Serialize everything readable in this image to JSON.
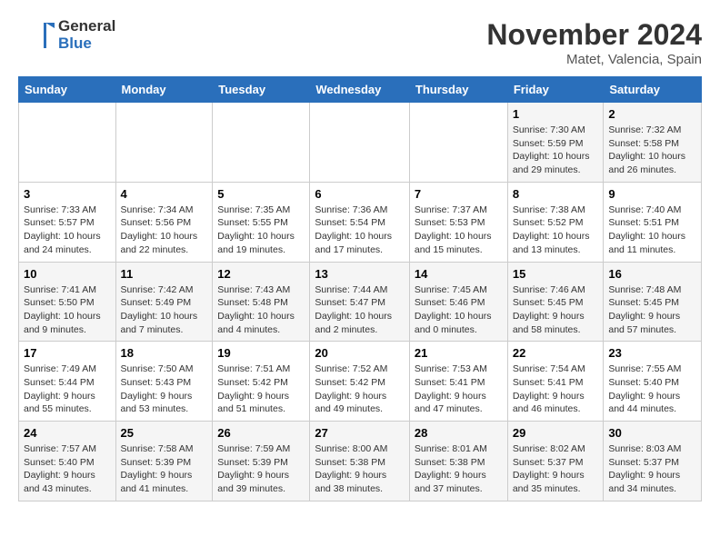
{
  "logo": {
    "line1": "General",
    "line2": "Blue"
  },
  "title": "November 2024",
  "location": "Matet, Valencia, Spain",
  "weekdays": [
    "Sunday",
    "Monday",
    "Tuesday",
    "Wednesday",
    "Thursday",
    "Friday",
    "Saturday"
  ],
  "weeks": [
    [
      {
        "day": "",
        "info": ""
      },
      {
        "day": "",
        "info": ""
      },
      {
        "day": "",
        "info": ""
      },
      {
        "day": "",
        "info": ""
      },
      {
        "day": "",
        "info": ""
      },
      {
        "day": "1",
        "info": "Sunrise: 7:30 AM\nSunset: 5:59 PM\nDaylight: 10 hours and 29 minutes."
      },
      {
        "day": "2",
        "info": "Sunrise: 7:32 AM\nSunset: 5:58 PM\nDaylight: 10 hours and 26 minutes."
      }
    ],
    [
      {
        "day": "3",
        "info": "Sunrise: 7:33 AM\nSunset: 5:57 PM\nDaylight: 10 hours and 24 minutes."
      },
      {
        "day": "4",
        "info": "Sunrise: 7:34 AM\nSunset: 5:56 PM\nDaylight: 10 hours and 22 minutes."
      },
      {
        "day": "5",
        "info": "Sunrise: 7:35 AM\nSunset: 5:55 PM\nDaylight: 10 hours and 19 minutes."
      },
      {
        "day": "6",
        "info": "Sunrise: 7:36 AM\nSunset: 5:54 PM\nDaylight: 10 hours and 17 minutes."
      },
      {
        "day": "7",
        "info": "Sunrise: 7:37 AM\nSunset: 5:53 PM\nDaylight: 10 hours and 15 minutes."
      },
      {
        "day": "8",
        "info": "Sunrise: 7:38 AM\nSunset: 5:52 PM\nDaylight: 10 hours and 13 minutes."
      },
      {
        "day": "9",
        "info": "Sunrise: 7:40 AM\nSunset: 5:51 PM\nDaylight: 10 hours and 11 minutes."
      }
    ],
    [
      {
        "day": "10",
        "info": "Sunrise: 7:41 AM\nSunset: 5:50 PM\nDaylight: 10 hours and 9 minutes."
      },
      {
        "day": "11",
        "info": "Sunrise: 7:42 AM\nSunset: 5:49 PM\nDaylight: 10 hours and 7 minutes."
      },
      {
        "day": "12",
        "info": "Sunrise: 7:43 AM\nSunset: 5:48 PM\nDaylight: 10 hours and 4 minutes."
      },
      {
        "day": "13",
        "info": "Sunrise: 7:44 AM\nSunset: 5:47 PM\nDaylight: 10 hours and 2 minutes."
      },
      {
        "day": "14",
        "info": "Sunrise: 7:45 AM\nSunset: 5:46 PM\nDaylight: 10 hours and 0 minutes."
      },
      {
        "day": "15",
        "info": "Sunrise: 7:46 AM\nSunset: 5:45 PM\nDaylight: 9 hours and 58 minutes."
      },
      {
        "day": "16",
        "info": "Sunrise: 7:48 AM\nSunset: 5:45 PM\nDaylight: 9 hours and 57 minutes."
      }
    ],
    [
      {
        "day": "17",
        "info": "Sunrise: 7:49 AM\nSunset: 5:44 PM\nDaylight: 9 hours and 55 minutes."
      },
      {
        "day": "18",
        "info": "Sunrise: 7:50 AM\nSunset: 5:43 PM\nDaylight: 9 hours and 53 minutes."
      },
      {
        "day": "19",
        "info": "Sunrise: 7:51 AM\nSunset: 5:42 PM\nDaylight: 9 hours and 51 minutes."
      },
      {
        "day": "20",
        "info": "Sunrise: 7:52 AM\nSunset: 5:42 PM\nDaylight: 9 hours and 49 minutes."
      },
      {
        "day": "21",
        "info": "Sunrise: 7:53 AM\nSunset: 5:41 PM\nDaylight: 9 hours and 47 minutes."
      },
      {
        "day": "22",
        "info": "Sunrise: 7:54 AM\nSunset: 5:41 PM\nDaylight: 9 hours and 46 minutes."
      },
      {
        "day": "23",
        "info": "Sunrise: 7:55 AM\nSunset: 5:40 PM\nDaylight: 9 hours and 44 minutes."
      }
    ],
    [
      {
        "day": "24",
        "info": "Sunrise: 7:57 AM\nSunset: 5:40 PM\nDaylight: 9 hours and 43 minutes."
      },
      {
        "day": "25",
        "info": "Sunrise: 7:58 AM\nSunset: 5:39 PM\nDaylight: 9 hours and 41 minutes."
      },
      {
        "day": "26",
        "info": "Sunrise: 7:59 AM\nSunset: 5:39 PM\nDaylight: 9 hours and 39 minutes."
      },
      {
        "day": "27",
        "info": "Sunrise: 8:00 AM\nSunset: 5:38 PM\nDaylight: 9 hours and 38 minutes."
      },
      {
        "day": "28",
        "info": "Sunrise: 8:01 AM\nSunset: 5:38 PM\nDaylight: 9 hours and 37 minutes."
      },
      {
        "day": "29",
        "info": "Sunrise: 8:02 AM\nSunset: 5:37 PM\nDaylight: 9 hours and 35 minutes."
      },
      {
        "day": "30",
        "info": "Sunrise: 8:03 AM\nSunset: 5:37 PM\nDaylight: 9 hours and 34 minutes."
      }
    ]
  ]
}
